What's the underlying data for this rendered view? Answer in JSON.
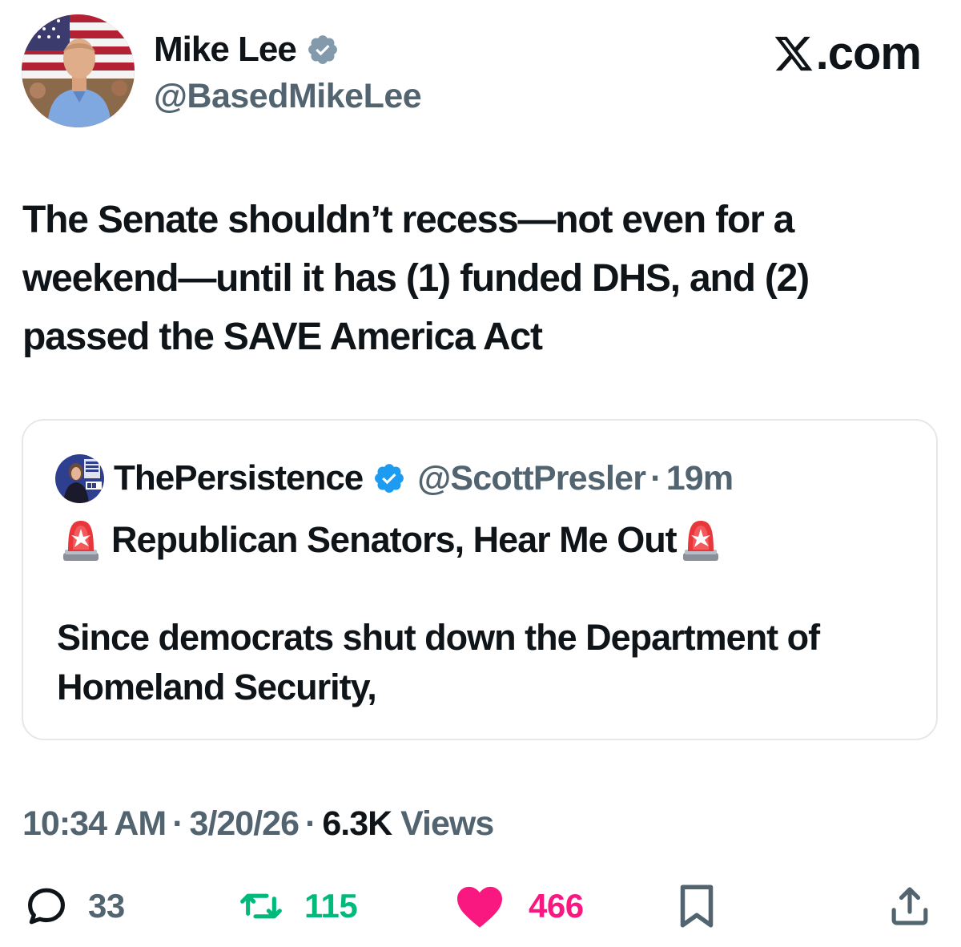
{
  "author": {
    "name": "Mike Lee",
    "handle": "@BasedMikeLee",
    "verified": true,
    "avatar_icon": "profile-photo-flag-background"
  },
  "brand": {
    "label": ".com",
    "logo_icon": "x-logo-icon"
  },
  "tweet": {
    "text": "The Senate shouldn’t recess—not even for a weekend—until it has (1) funded DHS, and (2) passed the SAVE America Act"
  },
  "quoted": {
    "name": "ThePersistence",
    "handle": "@ScottPresler",
    "separator": "·",
    "time": "19m",
    "verified": true,
    "headline": "Republican Senators, Hear Me Out",
    "headline_icon": "police-siren-emoji",
    "body": "Since democrats shut down the Department of Homeland Security,"
  },
  "meta": {
    "time": "10:34 AM",
    "separator": "·",
    "date": "3/20/26",
    "views_count": "6.3K",
    "views_label": "Views"
  },
  "actions": {
    "replies": "33",
    "reposts": "115",
    "likes": "466"
  },
  "colors": {
    "text": "#0f1419",
    "secondary": "#536471",
    "verified": "#1d9bf0",
    "repost": "#00ba7c",
    "like": "#f91880",
    "border": "#e5e8eb"
  }
}
